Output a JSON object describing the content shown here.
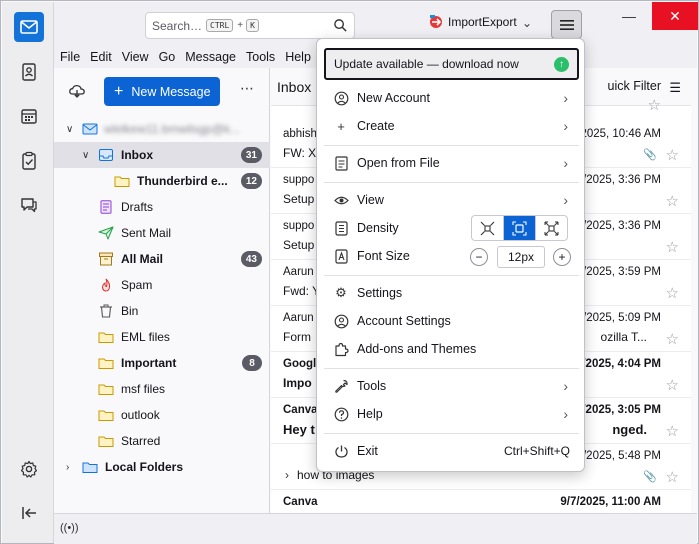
{
  "search": {
    "placeholder": "Search…",
    "key1": "CTRL",
    "key2": "K"
  },
  "addon": {
    "label": "ImportExport"
  },
  "menubar": [
    "File",
    "Edit",
    "View",
    "Go",
    "Message",
    "Tools",
    "Help"
  ],
  "folder_pane": {
    "new_message": "New Message",
    "account": "wlelkew11.bmwilsgp@k...",
    "folders": [
      {
        "label": "Inbox",
        "badge": "31",
        "bold": true
      },
      {
        "label": "Thunderbird e...",
        "badge": "12",
        "bold": true
      },
      {
        "label": "Drafts"
      },
      {
        "label": "Sent Mail"
      },
      {
        "label": "All Mail",
        "badge": "43",
        "bold": true
      },
      {
        "label": "Spam"
      },
      {
        "label": "Bin"
      },
      {
        "label": "EML files"
      },
      {
        "label": "Important",
        "badge": "8",
        "bold": true
      },
      {
        "label": "msf files"
      },
      {
        "label": "outlook"
      },
      {
        "label": "Starred"
      }
    ],
    "local_folders": "Local Folders"
  },
  "message_list": {
    "title": "Inbox",
    "quick_filter": "uick Filter",
    "rows": [
      {
        "sender": "abhish",
        "date": "2025, 10:46 AM",
        "subject": "FW: X",
        "subject_right": ""
      },
      {
        "sender": "suppo",
        "date": "/2025, 3:36 PM",
        "subject": "Setup",
        "subject_right": ""
      },
      {
        "sender": "suppo",
        "date": "/2025, 3:36 PM",
        "subject": "Setup",
        "subject_right": ""
      },
      {
        "sender": "Aarun",
        "date": "/2025, 3:59 PM",
        "subject": "Fwd: Y",
        "subject_right": ""
      },
      {
        "sender": "Aarun",
        "date": "/2025, 5:09 PM",
        "subject": "Form",
        "subject_right": "ozilla T..."
      },
      {
        "sender": "Googl",
        "date": "/2025, 4:04 PM",
        "subject": "Impo",
        "subject_right": "",
        "bold": true
      },
      {
        "sender": "Canva",
        "date": "/2025, 3:05 PM",
        "subject": "Hey t",
        "subject_right": "nged.",
        "bold": true
      },
      {
        "sender": "",
        "date": "5/2025, 5:48 PM",
        "subject": "how to images",
        "subject_right": ""
      },
      {
        "sender": "Canva",
        "date": "9/7/2025, 11:00 AM",
        "subject": "",
        "subject_right": "",
        "bold": true
      }
    ]
  },
  "app_menu": {
    "update": "Update available — download now",
    "new_account": "New Account",
    "create": "Create",
    "open_from_file": "Open from File",
    "view": "View",
    "density": "Density",
    "font_size": "Font Size",
    "font_size_value": "12px",
    "settings": "Settings",
    "account_settings": "Account Settings",
    "addons": "Add-ons and Themes",
    "tools": "Tools",
    "help": "Help",
    "exit": "Exit",
    "exit_shortcut": "Ctrl+Shift+Q"
  },
  "colors": {
    "accent": "#0b63d4",
    "update_green": "#2ac06b",
    "close_red": "#e81123"
  }
}
